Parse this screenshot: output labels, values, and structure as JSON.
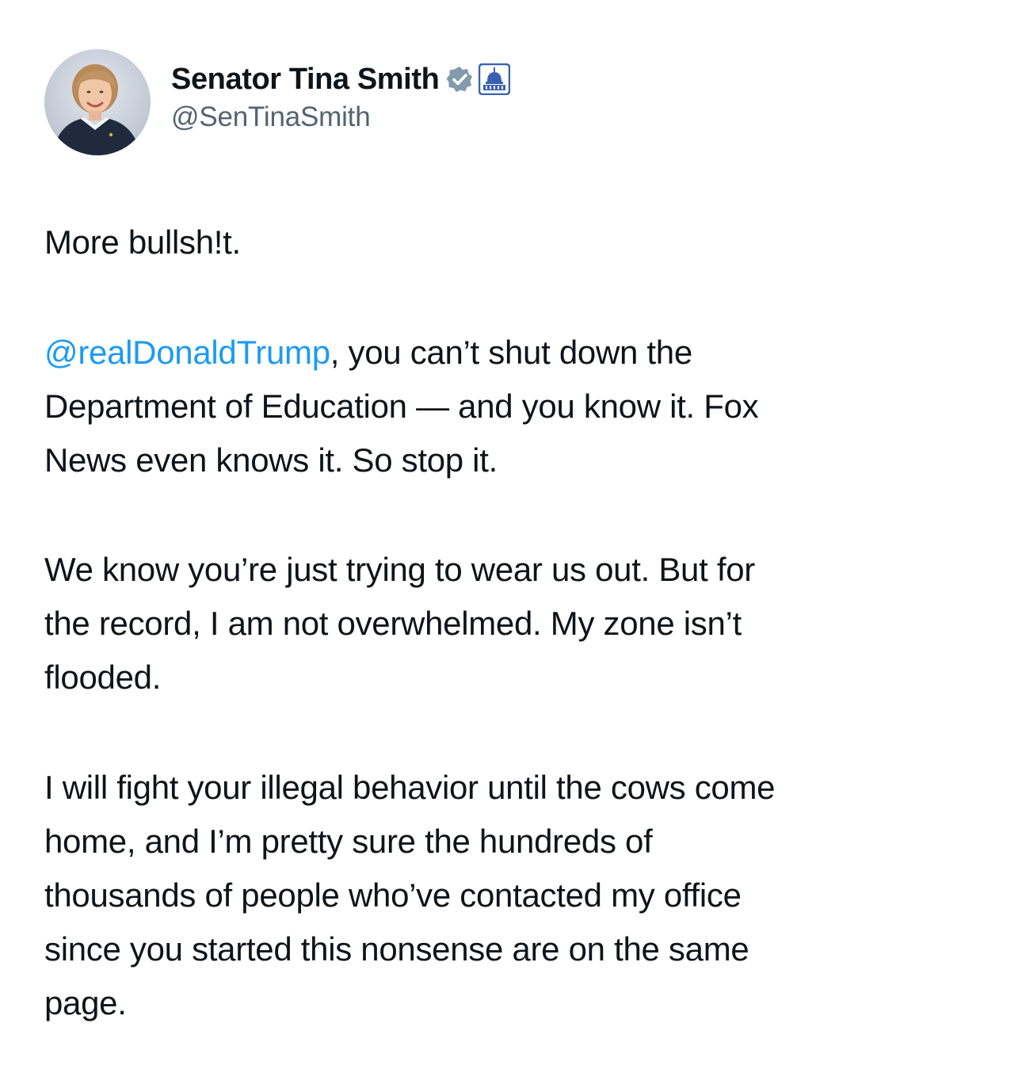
{
  "author": {
    "display_name": "Senator Tina Smith",
    "handle": "@SenTinaSmith",
    "verified_badge_icon": "verified-badge-icon",
    "affiliation_icon": "us-capitol-icon",
    "avatar": "profile-photo",
    "colors": {
      "verified_badge": "#829aab",
      "affiliation_badge": "#3b5fb0"
    }
  },
  "tweet": {
    "paragraph_1": "More bullsh!t.",
    "paragraph_2": {
      "mention": "@realDonaldTrump",
      "line_1_rest": ", you can’t shut down the",
      "line_2": "Department of Education — and you know it. Fox",
      "line_3": "News even knows it. So stop it."
    },
    "paragraph_3": {
      "line_1": "We know you’re just trying to wear us out. But for",
      "line_2": "the record, I am not overwhelmed. My zone isn’t",
      "line_3": "flooded."
    },
    "paragraph_4": {
      "line_1": "I will fight your illegal behavior until the cows come",
      "line_2": "home, and I’m pretty sure the hundreds of",
      "line_3": "thousands of people who’ve contacted my office",
      "line_4": "since you started this nonsense are on the same",
      "line_5": "page."
    },
    "colors": {
      "text": "#0f1419",
      "mention": "#1d9bf0",
      "handle": "#536471"
    }
  }
}
